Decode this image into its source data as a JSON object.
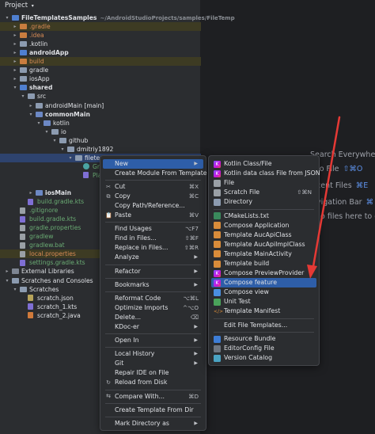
{
  "panel": {
    "title": "Project"
  },
  "tree": [
    {
      "label": "FileTemplatesSamples",
      "suffix": "~/AndroidStudioProjects/samples/FileTemp",
      "indent": 0,
      "arrow": "▾",
      "icon": "folder-blue",
      "style": "c-bold",
      "hl": "",
      "icon_name": "project-folder-icon"
    },
    {
      "label": ".gradle",
      "indent": 1,
      "arrow": "▸",
      "icon": "folder-orange",
      "style": "c-orange",
      "hl": "hl-yellow",
      "icon_name": "folder-icon"
    },
    {
      "label": ".idea",
      "indent": 1,
      "arrow": "▸",
      "icon": "folder-orange",
      "style": "c-orange",
      "hl": "",
      "icon_name": "folder-icon"
    },
    {
      "label": ".kotlin",
      "indent": 1,
      "arrow": "▸",
      "icon": "folder",
      "style": "c-white",
      "hl": "",
      "icon_name": "folder-icon"
    },
    {
      "label": "androidApp",
      "indent": 1,
      "arrow": "▸",
      "icon": "folder-blue",
      "style": "c-bold",
      "hl": "",
      "icon_name": "module-folder-icon"
    },
    {
      "label": "build",
      "indent": 1,
      "arrow": "▸",
      "icon": "folder-orange",
      "style": "c-orange",
      "hl": "hl-yellow",
      "icon_name": "folder-icon"
    },
    {
      "label": "gradle",
      "indent": 1,
      "arrow": "▸",
      "icon": "folder",
      "style": "c-white",
      "hl": "",
      "icon_name": "folder-icon"
    },
    {
      "label": "iosApp",
      "indent": 1,
      "arrow": "▸",
      "icon": "folder",
      "style": "c-white",
      "hl": "",
      "icon_name": "folder-icon"
    },
    {
      "label": "shared",
      "indent": 1,
      "arrow": "▾",
      "icon": "folder-blue",
      "style": "c-bold",
      "hl": "",
      "icon_name": "module-folder-icon"
    },
    {
      "label": "src",
      "indent": 2,
      "arrow": "▾",
      "icon": "folder",
      "style": "c-white",
      "hl": "",
      "icon_name": "folder-icon"
    },
    {
      "label": "androidMain [main]",
      "indent": 3,
      "arrow": "▸",
      "icon": "folder",
      "style": "c-white",
      "hl": "",
      "icon_name": "folder-icon"
    },
    {
      "label": "commonMain",
      "indent": 3,
      "arrow": "▾",
      "icon": "folder-src",
      "style": "c-bold",
      "hl": "",
      "icon_name": "source-folder-icon"
    },
    {
      "label": "kotlin",
      "indent": 4,
      "arrow": "▾",
      "icon": "folder-src",
      "style": "c-white",
      "hl": "",
      "icon_name": "source-folder-icon"
    },
    {
      "label": "io",
      "indent": 5,
      "arrow": "▾",
      "icon": "folder",
      "style": "c-white",
      "hl": "",
      "icon_name": "folder-icon"
    },
    {
      "label": "github",
      "indent": 6,
      "arrow": "▾",
      "icon": "folder",
      "style": "c-white",
      "hl": "",
      "icon_name": "folder-icon"
    },
    {
      "label": "dmitriy1892",
      "indent": 7,
      "arrow": "▾",
      "icon": "folder",
      "style": "c-white",
      "hl": "",
      "icon_name": "folder-icon"
    },
    {
      "label": "filetem",
      "indent": 8,
      "arrow": "▾",
      "icon": "folder",
      "style": "c-white",
      "hl": "selected",
      "icon_name": "folder-icon"
    },
    {
      "label": "Gre",
      "indent": 9,
      "arrow": "",
      "icon": "cd",
      "style": "c-green",
      "hl": "",
      "icon_name": "composable-icon"
    },
    {
      "label": "Pla",
      "indent": 9,
      "arrow": "",
      "icon": "file-kts",
      "style": "c-green",
      "hl": "",
      "icon_name": "kotlin-file-icon"
    },
    {
      "label": "",
      "indent": 9,
      "arrow": "",
      "icon": "",
      "style": "c-white",
      "hl": "",
      "icon_name": ""
    },
    {
      "label": "iosMain",
      "indent": 3,
      "arrow": "▸",
      "icon": "folder-src",
      "style": "c-bold",
      "hl": "",
      "icon_name": "source-folder-icon"
    },
    {
      "label": "build.gradle.kts",
      "indent": 2,
      "arrow": "",
      "icon": "file-kts",
      "style": "c-green",
      "hl": "",
      "icon_name": "gradle-file-icon"
    },
    {
      "label": ".gitignore",
      "indent": 1,
      "arrow": "",
      "icon": "file-gray",
      "style": "c-green",
      "hl": "",
      "icon_name": "file-icon"
    },
    {
      "label": "build.gradle.kts",
      "indent": 1,
      "arrow": "",
      "icon": "file-kts",
      "style": "c-green",
      "hl": "",
      "icon_name": "gradle-file-icon"
    },
    {
      "label": "gradle.properties",
      "indent": 1,
      "arrow": "",
      "icon": "file-gray",
      "style": "c-green",
      "hl": "",
      "icon_name": "properties-file-icon"
    },
    {
      "label": "gradlew",
      "indent": 1,
      "arrow": "",
      "icon": "file-gray",
      "style": "c-green",
      "hl": "",
      "icon_name": "file-icon"
    },
    {
      "label": "gradlew.bat",
      "indent": 1,
      "arrow": "",
      "icon": "file-gray",
      "style": "c-green",
      "hl": "",
      "icon_name": "file-icon"
    },
    {
      "label": "local.properties",
      "indent": 1,
      "arrow": "",
      "icon": "file-gray",
      "style": "c-orange",
      "hl": "hl-yellow",
      "icon_name": "properties-file-icon"
    },
    {
      "label": "settings.gradle.kts",
      "indent": 1,
      "arrow": "",
      "icon": "file-kts",
      "style": "c-green",
      "hl": "",
      "icon_name": "gradle-file-icon"
    },
    {
      "label": "External Libraries",
      "indent": 0,
      "arrow": "▸",
      "icon": "lib",
      "style": "c-white",
      "hl": "",
      "icon_name": "library-icon"
    },
    {
      "label": "Scratches and Consoles",
      "indent": 0,
      "arrow": "▾",
      "icon": "folder",
      "style": "c-white",
      "hl": "",
      "icon_name": "scratches-icon"
    },
    {
      "label": "Scratches",
      "indent": 1,
      "arrow": "▾",
      "icon": "folder",
      "style": "c-white",
      "hl": "",
      "icon_name": "folder-icon"
    },
    {
      "label": "scratch.json",
      "indent": 2,
      "arrow": "",
      "icon": "file-json",
      "style": "c-white",
      "hl": "",
      "icon_name": "json-file-icon"
    },
    {
      "label": "scratch_1.kts",
      "indent": 2,
      "arrow": "",
      "icon": "file-kts",
      "style": "c-white",
      "hl": "",
      "icon_name": "kotlin-script-icon"
    },
    {
      "label": "scratch_2.java",
      "indent": 2,
      "arrow": "",
      "icon": "file-java",
      "style": "c-white",
      "hl": "",
      "icon_name": "java-file-icon"
    }
  ],
  "hints": [
    {
      "text": "Search Everywhere",
      "kb": ""
    },
    {
      "text": "to File",
      "kb": "⇧⌘O"
    },
    {
      "text": "cent Files",
      "kb": "⌘E"
    },
    {
      "text": "vigation Bar",
      "kb": "⌘↑"
    },
    {
      "text": "o files here to op",
      "kb": ""
    }
  ],
  "context_menu": [
    {
      "label": "New",
      "sc": "",
      "sub": true,
      "icon": "",
      "active": true,
      "name": "menu-new"
    },
    {
      "label": "Create Module From Template",
      "sc": "",
      "sub": false,
      "icon": "",
      "active": false,
      "name": "menu-create-module-from-template"
    },
    {
      "sep": true
    },
    {
      "label": "Cut",
      "sc": "⌘X",
      "sub": false,
      "icon": "✂",
      "active": false,
      "name": "menu-cut"
    },
    {
      "label": "Copy",
      "sc": "⌘C",
      "sub": false,
      "icon": "⧉",
      "active": false,
      "name": "menu-copy"
    },
    {
      "label": "Copy Path/Reference...",
      "sc": "",
      "sub": false,
      "icon": "",
      "active": false,
      "name": "menu-copy-path"
    },
    {
      "label": "Paste",
      "sc": "⌘V",
      "sub": false,
      "icon": "📋",
      "active": false,
      "name": "menu-paste"
    },
    {
      "sep": true
    },
    {
      "label": "Find Usages",
      "sc": "⌥F7",
      "sub": false,
      "icon": "",
      "active": false,
      "name": "menu-find-usages"
    },
    {
      "label": "Find in Files...",
      "sc": "⇧⌘F",
      "sub": false,
      "icon": "",
      "active": false,
      "name": "menu-find-in-files"
    },
    {
      "label": "Replace in Files...",
      "sc": "⇧⌘R",
      "sub": false,
      "icon": "",
      "active": false,
      "name": "menu-replace-in-files"
    },
    {
      "label": "Analyze",
      "sc": "",
      "sub": true,
      "icon": "",
      "active": false,
      "name": "menu-analyze"
    },
    {
      "sep": true
    },
    {
      "label": "Refactor",
      "sc": "",
      "sub": true,
      "icon": "",
      "active": false,
      "name": "menu-refactor"
    },
    {
      "sep": true
    },
    {
      "label": "Bookmarks",
      "sc": "",
      "sub": true,
      "icon": "",
      "active": false,
      "name": "menu-bookmarks"
    },
    {
      "sep": true
    },
    {
      "label": "Reformat Code",
      "sc": "⌥⌘L",
      "sub": false,
      "icon": "",
      "active": false,
      "name": "menu-reformat-code"
    },
    {
      "label": "Optimize Imports",
      "sc": "^⌥O",
      "sub": false,
      "icon": "",
      "active": false,
      "name": "menu-optimize-imports"
    },
    {
      "label": "Delete...",
      "sc": "⌫",
      "sub": false,
      "icon": "",
      "active": false,
      "name": "menu-delete"
    },
    {
      "label": "KDoc-er",
      "sc": "",
      "sub": true,
      "icon": "",
      "active": false,
      "name": "menu-kdoc-er"
    },
    {
      "sep": true
    },
    {
      "label": "Open In",
      "sc": "",
      "sub": true,
      "icon": "",
      "active": false,
      "name": "menu-open-in"
    },
    {
      "sep": true
    },
    {
      "label": "Local History",
      "sc": "",
      "sub": true,
      "icon": "",
      "active": false,
      "name": "menu-local-history"
    },
    {
      "label": "Git",
      "sc": "",
      "sub": true,
      "icon": "",
      "active": false,
      "name": "menu-git"
    },
    {
      "label": "Repair IDE on File",
      "sc": "",
      "sub": false,
      "icon": "",
      "active": false,
      "name": "menu-repair-ide"
    },
    {
      "label": "Reload from Disk",
      "sc": "",
      "sub": false,
      "icon": "↻",
      "active": false,
      "name": "menu-reload-from-disk"
    },
    {
      "sep": true
    },
    {
      "label": "Compare With...",
      "sc": "⌘D",
      "sub": false,
      "icon": "⇆",
      "active": false,
      "name": "menu-compare-with"
    },
    {
      "sep": true
    },
    {
      "label": "Create Template From Dir",
      "sc": "",
      "sub": false,
      "icon": "",
      "active": false,
      "name": "menu-create-template-from-dir"
    },
    {
      "sep": true
    },
    {
      "label": "Mark Directory as",
      "sc": "",
      "sub": true,
      "icon": "",
      "active": false,
      "name": "menu-mark-directory-as"
    }
  ],
  "new_submenu": [
    {
      "label": "Kotlin Class/File",
      "icon": "k-kotlin",
      "glyph": "K",
      "active": false,
      "name": "new-kotlin-class-file"
    },
    {
      "label": "Kotlin data class File from JSON",
      "icon": "k-kotlin",
      "glyph": "K",
      "active": false,
      "name": "new-kotlin-data-class-json"
    },
    {
      "label": "File",
      "icon": "k-file",
      "glyph": "",
      "active": false,
      "name": "new-file"
    },
    {
      "label": "Scratch File",
      "icon": "k-file",
      "glyph": "",
      "sc": "⇧⌘N",
      "active": false,
      "name": "new-scratch-file"
    },
    {
      "label": "Directory",
      "icon": "k-dir",
      "glyph": "",
      "active": false,
      "name": "new-directory"
    },
    {
      "sep": true
    },
    {
      "label": "CMakeLists.txt",
      "icon": "k-cmake",
      "glyph": "",
      "active": false,
      "name": "new-cmakelists"
    },
    {
      "label": "Compose Application",
      "icon": "k-tmpl",
      "glyph": "",
      "active": false,
      "name": "new-compose-application"
    },
    {
      "label": "Template AucApiClass",
      "icon": "k-tmpl",
      "glyph": "",
      "active": false,
      "name": "new-template-aucapiclass"
    },
    {
      "label": "Template AucApiImplClass",
      "icon": "k-tmpl",
      "glyph": "",
      "active": false,
      "name": "new-template-aucapiimplclass"
    },
    {
      "label": "Template MainActivity",
      "icon": "k-tmpl",
      "glyph": "",
      "active": false,
      "name": "new-template-mainactivity"
    },
    {
      "label": "Template build",
      "icon": "k-tmpl",
      "glyph": "",
      "active": false,
      "name": "new-template-build"
    },
    {
      "label": "Compose PreviewProvider",
      "icon": "k-kotlin",
      "glyph": "K",
      "active": false,
      "name": "new-compose-previewprovider"
    },
    {
      "label": "Compose feature",
      "icon": "k-kotlin",
      "glyph": "K",
      "active": true,
      "name": "new-compose-feature"
    },
    {
      "label": "Compose view",
      "icon": "k-compose",
      "glyph": "",
      "active": false,
      "name": "new-compose-view"
    },
    {
      "label": "Unit Test",
      "icon": "k-test",
      "glyph": "",
      "active": false,
      "name": "new-unit-test"
    },
    {
      "label": "Template Manifest",
      "icon": "k-xml",
      "glyph": "</>",
      "active": false,
      "name": "new-template-manifest"
    },
    {
      "sep": true
    },
    {
      "label": "Edit File Templates...",
      "icon": "k-none",
      "glyph": "",
      "active": false,
      "name": "new-edit-file-templates"
    },
    {
      "sep": true
    },
    {
      "label": "Resource Bundle",
      "icon": "k-res",
      "glyph": "",
      "active": false,
      "name": "new-resource-bundle"
    },
    {
      "label": "EditorConfig File",
      "icon": "k-edit",
      "glyph": "",
      "active": false,
      "name": "new-editorconfig-file"
    },
    {
      "label": "Version Catalog",
      "icon": "k-ver",
      "glyph": "",
      "active": false,
      "name": "new-version-catalog"
    }
  ],
  "colors": {
    "accent": "#2e5ea8",
    "arrow": "#e53935"
  }
}
